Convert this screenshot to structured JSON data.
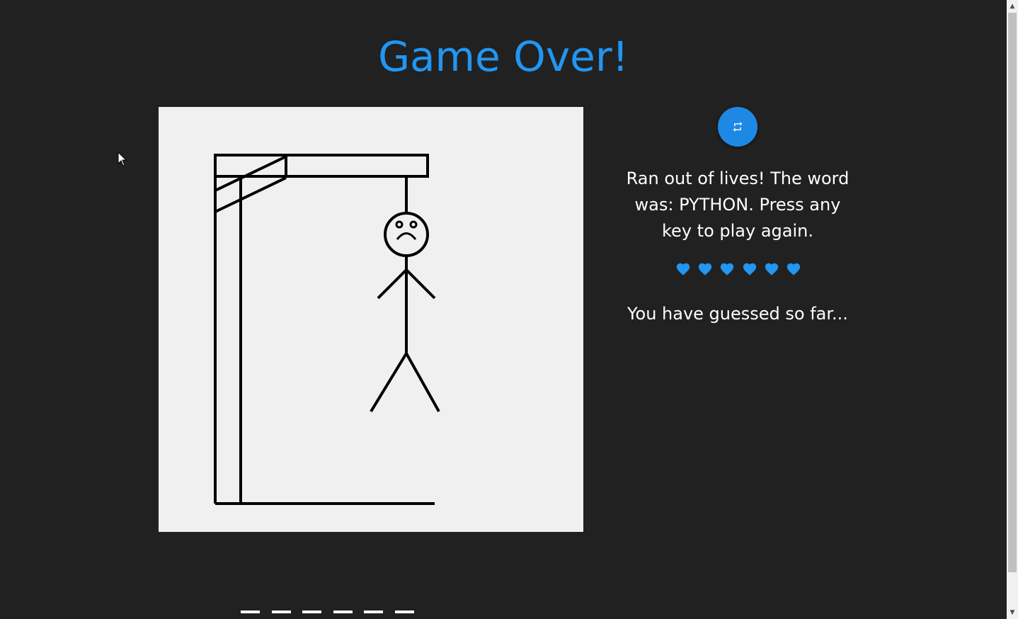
{
  "title": "Game Over!",
  "restart_button": {
    "icon": "repeat-icon",
    "color": "#1e88e5"
  },
  "message": "Ran out of lives! The word was: PYTHON. Press any key to play again.",
  "lives": {
    "count": 6,
    "icon": "heart-icon",
    "color": "#2196f3"
  },
  "guessed_label": "You have guessed so far...",
  "word_slots": 6,
  "colors": {
    "background": "#212121",
    "accent": "#2196f3",
    "board": "#f0f0f0",
    "text": "#ffffff"
  }
}
